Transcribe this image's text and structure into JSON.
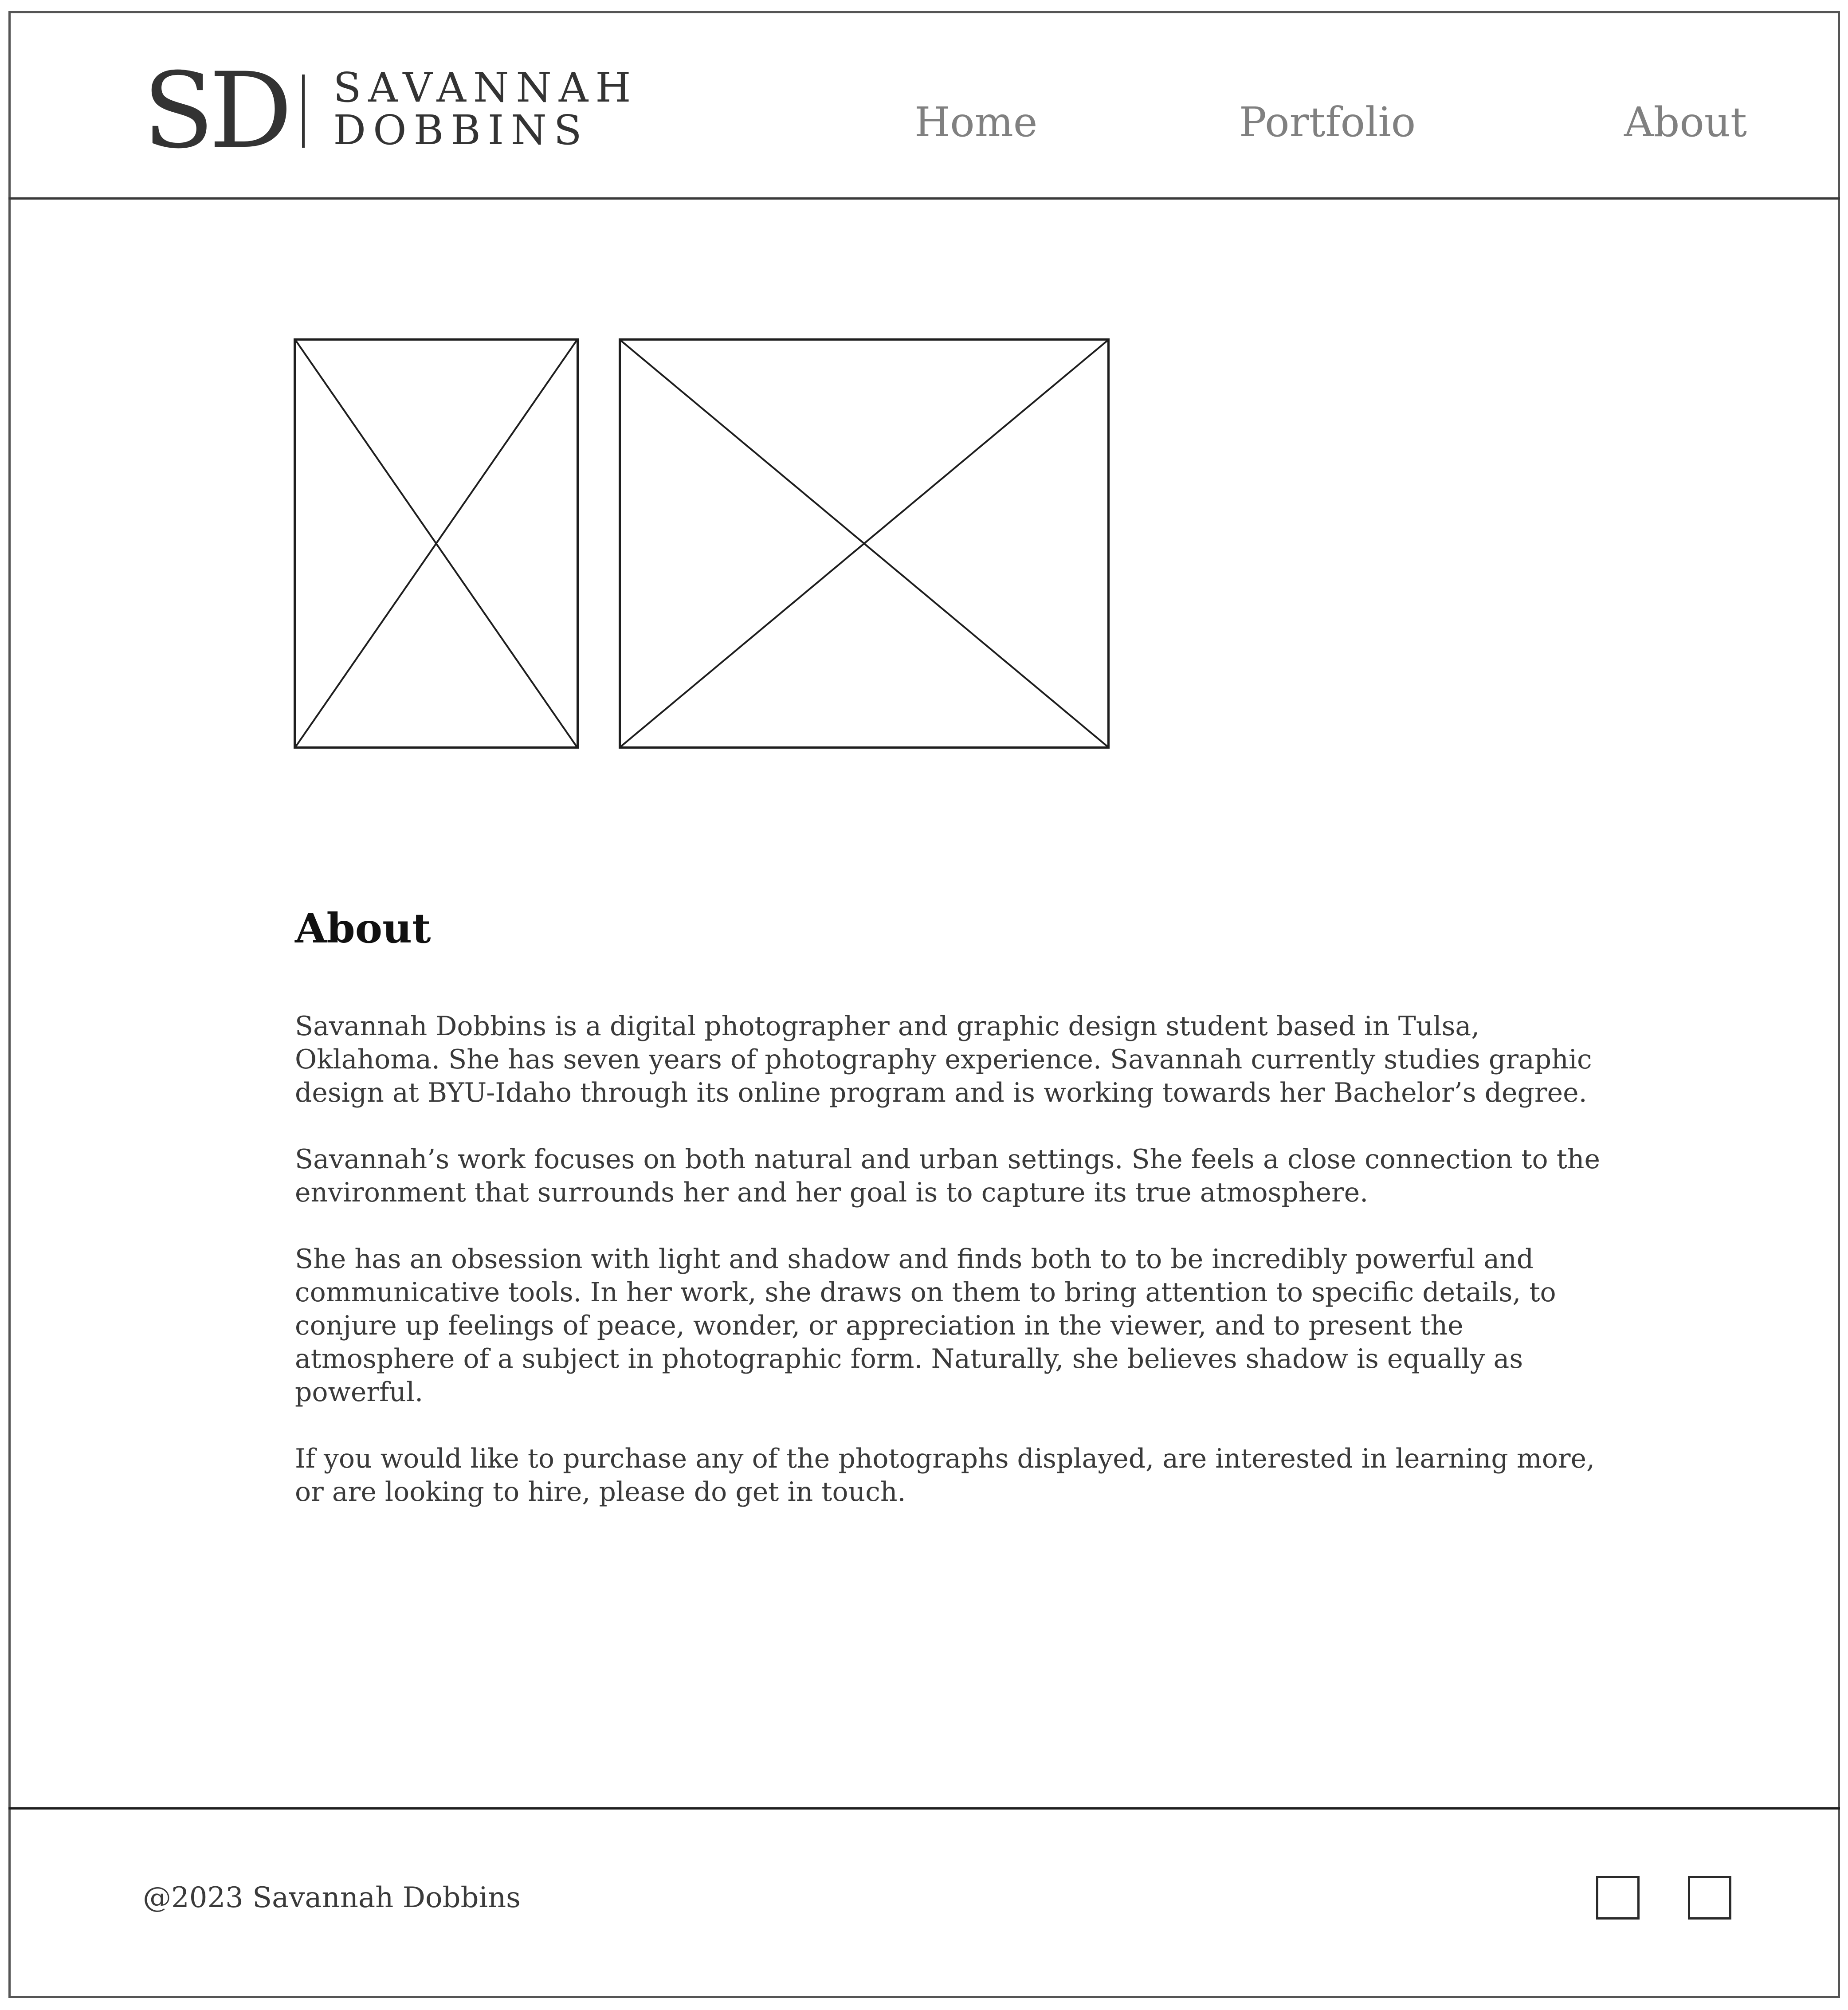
{
  "brand": {
    "monogram": "SD",
    "line1": "SAVANNAH",
    "line2": "DOBBINS"
  },
  "nav": {
    "items": [
      {
        "label": "Home"
      },
      {
        "label": "Portfolio"
      },
      {
        "label": "About"
      }
    ]
  },
  "main": {
    "images": [
      {
        "icon": "image-placeholder-icon"
      },
      {
        "icon": "image-placeholder-icon"
      }
    ],
    "about": {
      "heading": "About",
      "paragraphs": [
        "Savannah Dobbins is a digital photographer and graphic design student based in Tulsa, Oklahoma. She has seven years of photography experience. Savannah currently studies graphic design at BYU-Idaho through its online program and is working towards her Bachelor’s degree.",
        "Savannah’s work focuses on both natural and urban settings. She feels a close connection to the environment that surrounds her and her goal is to capture its true atmosphere.",
        "She has an obsession with light and shadow and finds both to to be incredibly powerful and communicative tools. In her work, she draws on them to bring attention to specific details, to conjure up feelings of peace, wonder, or appreciation in the viewer, and to present the atmosphere of a subject in photographic form. Naturally, she believes shadow is equally as powerful.",
        "If you would like to purchase any of the photographs displayed, are interested in learning more, or are looking to hire, please do get in touch."
      ]
    }
  },
  "footer": {
    "copyright": "@2023 Savannah Dobbins",
    "social_icons": [
      "social-link-icon",
      "social-link-icon"
    ]
  },
  "colors": {
    "nav_text": "#808080",
    "body_text": "#3a3a3a",
    "heading_text": "#111111",
    "border": "#3a3a3a"
  }
}
